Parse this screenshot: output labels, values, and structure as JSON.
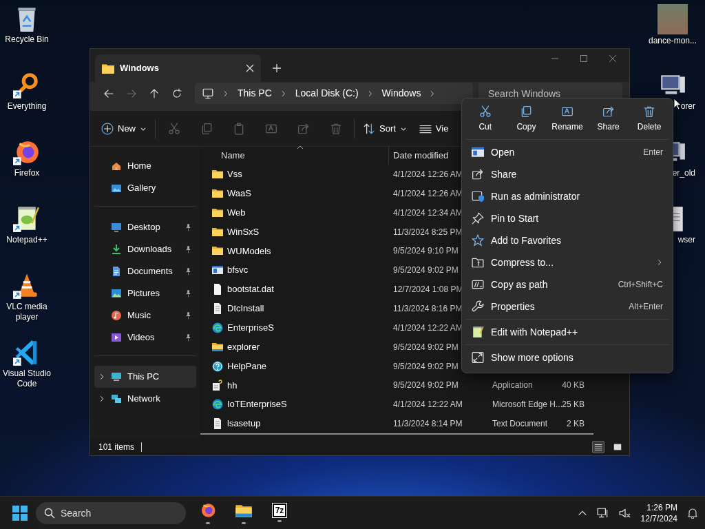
{
  "desktop_icons_left": [
    {
      "label": "Recycle Bin",
      "kind": "recycle",
      "shortcut": false
    },
    {
      "label": "Everything",
      "kind": "everything",
      "shortcut": true
    },
    {
      "label": "Firefox",
      "kind": "firefox",
      "shortcut": true
    },
    {
      "label": "Notepad++",
      "kind": "notepad",
      "shortcut": true
    },
    {
      "label": "VLC media player",
      "kind": "vlc",
      "shortcut": true
    },
    {
      "label": "Visual Studio Code",
      "kind": "vscode",
      "shortcut": true
    }
  ],
  "desktop_icons_right": [
    {
      "label": "dance-mon...",
      "kind": "photo"
    },
    {
      "label": "orer",
      "kind": "computer"
    },
    {
      "label": "er_old",
      "kind": "computer"
    },
    {
      "label": "wser",
      "kind": "document"
    }
  ],
  "explorer": {
    "tabs": [
      {
        "label": "Windows",
        "selected": true
      }
    ],
    "navigation": [
      {
        "kind": "back",
        "disabled": false
      },
      {
        "kind": "forward",
        "disabled": true
      },
      {
        "kind": "up",
        "disabled": false
      },
      {
        "kind": "refresh",
        "disabled": false
      }
    ],
    "breadcrumb": [
      "This PC",
      "Local Disk (C:)",
      "Windows"
    ],
    "search": {
      "placeholder": "Search Windows"
    },
    "command_bar": {
      "groups": [
        [
          {
            "kind": "new",
            "label": "New",
            "dropdown": true,
            "disabled": false
          }
        ],
        [
          {
            "kind": "cut",
            "disabled": true
          },
          {
            "kind": "copy",
            "disabled": true
          },
          {
            "kind": "paste",
            "disabled": true
          },
          {
            "kind": "rename",
            "disabled": true
          },
          {
            "kind": "share",
            "disabled": true
          },
          {
            "kind": "delete",
            "disabled": true
          }
        ],
        [
          {
            "kind": "sort",
            "label": "Sort",
            "dropdown": true,
            "disabled": false
          },
          {
            "kind": "view",
            "label": "Vie",
            "dropdown": false,
            "disabled": false
          }
        ]
      ]
    },
    "sidebar": {
      "groups": [
        [
          {
            "label": "Home",
            "kind": "home",
            "selected": false,
            "pinned": false
          },
          {
            "label": "Gallery",
            "kind": "gallery",
            "selected": false,
            "pinned": false
          }
        ],
        [
          {
            "label": "Desktop",
            "kind": "desktop",
            "selected": false,
            "pinned": true
          },
          {
            "label": "Downloads",
            "kind": "downloads",
            "selected": false,
            "pinned": true
          },
          {
            "label": "Documents",
            "kind": "documents",
            "selected": false,
            "pinned": true
          },
          {
            "label": "Pictures",
            "kind": "pictures",
            "selected": false,
            "pinned": true
          },
          {
            "label": "Music",
            "kind": "music",
            "selected": false,
            "pinned": true
          },
          {
            "label": "Videos",
            "kind": "videos",
            "selected": false,
            "pinned": true
          }
        ],
        [
          {
            "label": "This PC",
            "kind": "thispc",
            "selected": true,
            "pinned": false,
            "expanded": false
          },
          {
            "label": "Network",
            "kind": "network",
            "selected": false,
            "pinned": false,
            "expanded": false
          }
        ]
      ]
    },
    "table": {
      "columns": [
        {
          "label": "Name",
          "sorted": true
        },
        {
          "label": "Date modified",
          "sorted": false
        }
      ],
      "rows": [
        {
          "name": "Vss",
          "kind": "folder",
          "date": "4/1/2024 12:26 AM"
        },
        {
          "name": "WaaS",
          "kind": "folder",
          "date": "4/1/2024 12:26 AM"
        },
        {
          "name": "Web",
          "kind": "folder",
          "date": "4/1/2024 12:34 AM"
        },
        {
          "name": "WinSxS",
          "kind": "folder",
          "date": "11/3/2024 8:25 PM"
        },
        {
          "name": "WUModels",
          "kind": "folder",
          "date": "9/5/2024 9:10 PM"
        },
        {
          "name": "bfsvc",
          "kind": "app",
          "date": "9/5/2024 9:02 PM"
        },
        {
          "name": "bootstat.dat",
          "kind": "file",
          "date": "12/7/2024 1:08 PM"
        },
        {
          "name": "DtcInstall",
          "kind": "text",
          "date": "11/3/2024 8:16 PM"
        },
        {
          "name": "EnterpriseS",
          "kind": "edge",
          "date": "4/1/2024 12:22 AM"
        },
        {
          "name": "explorer",
          "kind": "explorer",
          "date": "9/5/2024 9:02 PM"
        },
        {
          "name": "HelpPane",
          "kind": "help",
          "date": "9/5/2024 9:02 PM"
        },
        {
          "name": "hh",
          "kind": "helpfile",
          "date": "9/5/2024 9:02 PM",
          "type": "Application",
          "size": "40 KB"
        },
        {
          "name": "IoTEnterpriseS",
          "kind": "edge",
          "date": "4/1/2024 12:22 AM",
          "type": "Microsoft Edge H...",
          "size": "25 KB"
        },
        {
          "name": "lsasetup",
          "kind": "text",
          "date": "11/3/2024 8:14 PM",
          "type": "Text Document",
          "size": "2 KB"
        }
      ]
    },
    "status_bar": {
      "count": "101 items",
      "views": [
        {
          "kind": "details",
          "selected": true
        },
        {
          "kind": "tiles",
          "selected": false
        }
      ]
    }
  },
  "context_menu": {
    "actions": [
      {
        "label": "Cut",
        "kind": "cut"
      },
      {
        "label": "Copy",
        "kind": "copy"
      },
      {
        "label": "Rename",
        "kind": "rename"
      },
      {
        "label": "Share",
        "kind": "share"
      },
      {
        "label": "Delete",
        "kind": "delete"
      }
    ],
    "groups": [
      [
        {
          "label": "Open",
          "kind": "open",
          "shortcut": "Enter",
          "submenu": false
        },
        {
          "label": "Share",
          "kind": "share",
          "submenu": false
        },
        {
          "label": "Run as administrator",
          "kind": "admin",
          "submenu": false
        },
        {
          "label": "Pin to Start",
          "kind": "pin",
          "submenu": false
        },
        {
          "label": "Add to Favorites",
          "kind": "star",
          "submenu": false
        },
        {
          "label": "Compress to...",
          "kind": "zip",
          "submenu": true
        },
        {
          "label": "Copy as path",
          "kind": "path",
          "shortcut": "Ctrl+Shift+C",
          "submenu": false
        },
        {
          "label": "Properties",
          "kind": "wrench",
          "shortcut": "Alt+Enter",
          "submenu": false
        }
      ],
      [
        {
          "label": "Edit with Notepad++",
          "kind": "notepad",
          "submenu": false
        }
      ],
      [
        {
          "label": "Show more options",
          "kind": "more",
          "submenu": false
        }
      ]
    ]
  },
  "taskbar": {
    "search": {
      "placeholder": "Search"
    },
    "apps": [
      {
        "kind": "firefox",
        "running": true
      },
      {
        "kind": "files",
        "running": true
      },
      {
        "kind": "archiver",
        "label": "7z",
        "running": true
      }
    ],
    "clock": {
      "time": "1:26 PM",
      "date": "12/7/2024"
    }
  }
}
